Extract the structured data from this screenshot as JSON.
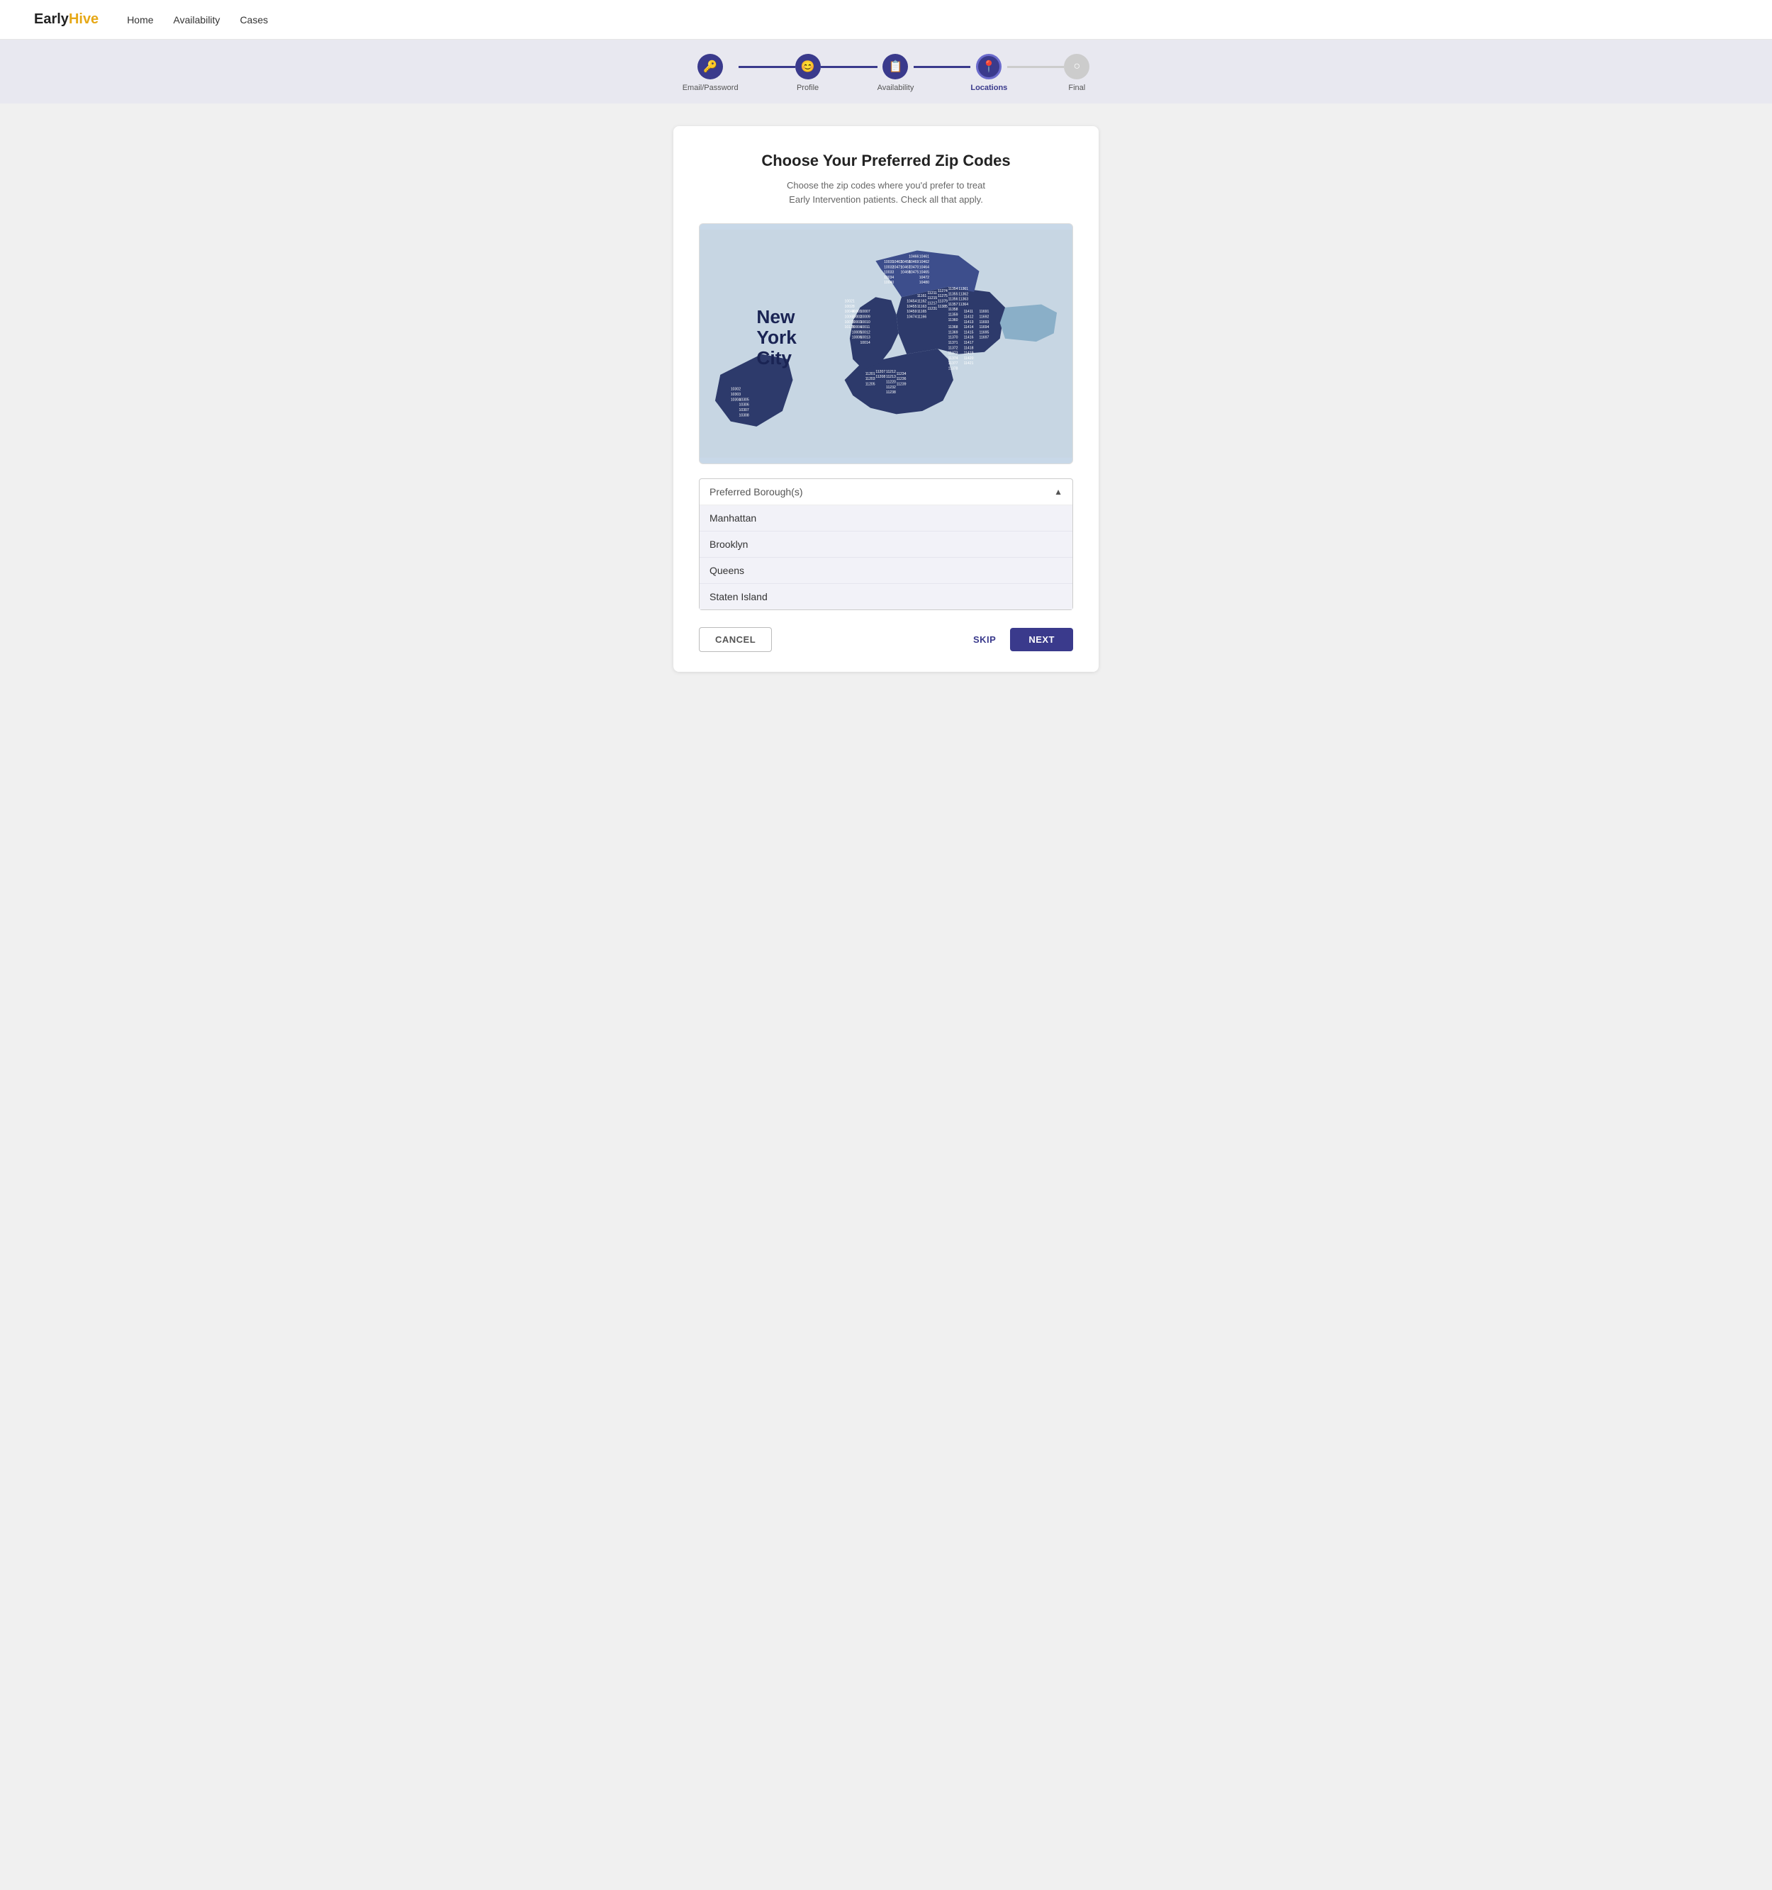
{
  "nav": {
    "logo_early": "Early",
    "logo_hive": "Hive",
    "links": [
      "Home",
      "Availability",
      "Cases"
    ]
  },
  "stepper": {
    "steps": [
      {
        "id": "email-password",
        "label": "Email/Password",
        "icon": "🔑",
        "state": "done"
      },
      {
        "id": "profile",
        "label": "Profile",
        "icon": "😊",
        "state": "done"
      },
      {
        "id": "availability",
        "label": "Availability",
        "icon": "📋",
        "state": "done"
      },
      {
        "id": "locations",
        "label": "Locations",
        "icon": "📍",
        "state": "active"
      },
      {
        "id": "final",
        "label": "Final",
        "icon": "○",
        "state": "inactive"
      }
    ]
  },
  "card": {
    "title": "Choose Your Preferred Zip Codes",
    "subtitle_line1": "Choose the zip codes where you'd prefer to treat",
    "subtitle_line2": "Early Intervention patients. Check all that apply.",
    "dropdown_placeholder": "Preferred Borough(s)",
    "boroughs": [
      "Manhattan",
      "Brooklyn",
      "Queens",
      "Staten Island"
    ],
    "btn_cancel": "CANCEL",
    "btn_skip": "SKIP",
    "btn_next": "NEXT"
  }
}
